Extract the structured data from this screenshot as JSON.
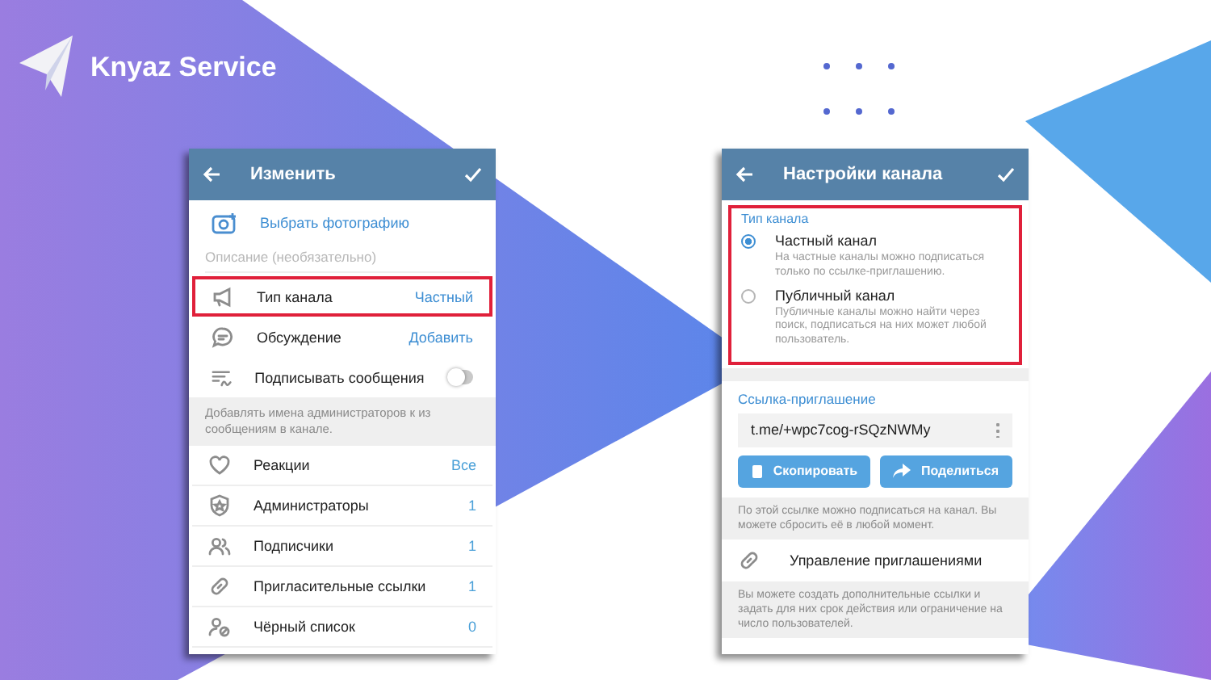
{
  "brand": {
    "name": "Knyaz Service"
  },
  "edit_screen": {
    "title": "Изменить",
    "photo_action": "Выбрать фотографию",
    "description_placeholder": "Описание (необязательно)",
    "rows": [
      {
        "kind": "value",
        "label": "Тип канала",
        "value": "Частный",
        "highlighted": true
      },
      {
        "kind": "value",
        "label": "Обсуждение",
        "value": "Добавить",
        "highlighted": false
      },
      {
        "kind": "toggle",
        "label": "Подписывать сообщения",
        "on": false,
        "highlighted": false
      }
    ],
    "hint": "Добавлять имена администраторов к из сообщениям в канале.",
    "list": [
      {
        "label": "Реакции",
        "value": "Все"
      },
      {
        "label": "Администраторы",
        "value": "1"
      },
      {
        "label": "Подписчики",
        "value": "1"
      },
      {
        "label": "Пригласительные ссылки",
        "value": "1"
      },
      {
        "label": "Чёрный список",
        "value": "0"
      }
    ]
  },
  "type_screen": {
    "title": "Настройки канала",
    "highlighted": true,
    "section": "Тип канала",
    "options": [
      {
        "label": "Частный канал",
        "description": "На частные каналы можно подписаться только по ссылке-приглашению.",
        "selected": true
      },
      {
        "label": "Публичный канал",
        "description": "Публичные каналы можно найти через поиск, подписаться на них может любой пользователь.",
        "selected": false
      }
    ],
    "link_section": "Ссылка-приглашение",
    "link": "t.me/+wpc7cog-rSQzNWMy",
    "buttons": [
      "Скопировать",
      "Поделиться"
    ],
    "link_hint": "По этой ссылке можно подписаться на канал. Вы можете сбросить её в любой момент.",
    "manage": "Управление приглашениями",
    "manage_hint": "Вы можете создать дополнительные ссылки и задать для них срок действия или ограничение на число пользователей."
  }
}
